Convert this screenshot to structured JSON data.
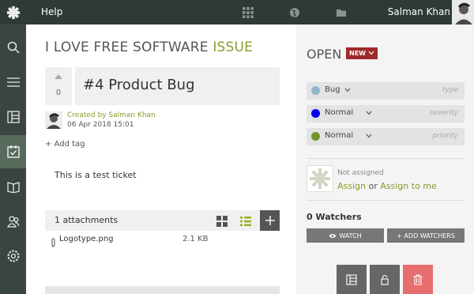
{
  "topbar": {
    "help_label": "Help",
    "username": "Salman Khan"
  },
  "issue": {
    "title_prefix": "I LOVE FREE SOFTWARE",
    "title_suffix": "ISSUE",
    "votes": "0",
    "subject": "#4 Product Bug",
    "created_by": "Created by Salman Khan",
    "created_date": "06 Apr 2018 15:01",
    "add_tag": "+ Add tag",
    "description": "This is a test ticket"
  },
  "attachments": {
    "header": "1 attachments",
    "add_label": "+",
    "items": [
      {
        "name": "Logotype.png",
        "size": "2.1 KB"
      }
    ]
  },
  "status": {
    "label": "OPEN",
    "badge": "NEW"
  },
  "attributes": [
    {
      "value": "Bug",
      "name": "type",
      "color": "#8fb6c9"
    },
    {
      "value": "Normal",
      "name": "severity",
      "color": "#0000ee"
    },
    {
      "value": "Normal",
      "name": "priority",
      "color": "#76922e"
    }
  ],
  "assignment": {
    "not_assigned": "Not assigned",
    "assign": "Assign",
    "or": "or",
    "assign_to_me": "Assign to me"
  },
  "watchers": {
    "title": "0 Watchers",
    "watch_label": "WATCH",
    "add_watchers_label": "+ ADD WATCHERS"
  },
  "colors": {
    "accent": "#8a9a2a",
    "badge": "#a02a2a",
    "delete": "#e76e6e",
    "topbar": "#2f3a35",
    "sidebar": "#3a4440"
  }
}
